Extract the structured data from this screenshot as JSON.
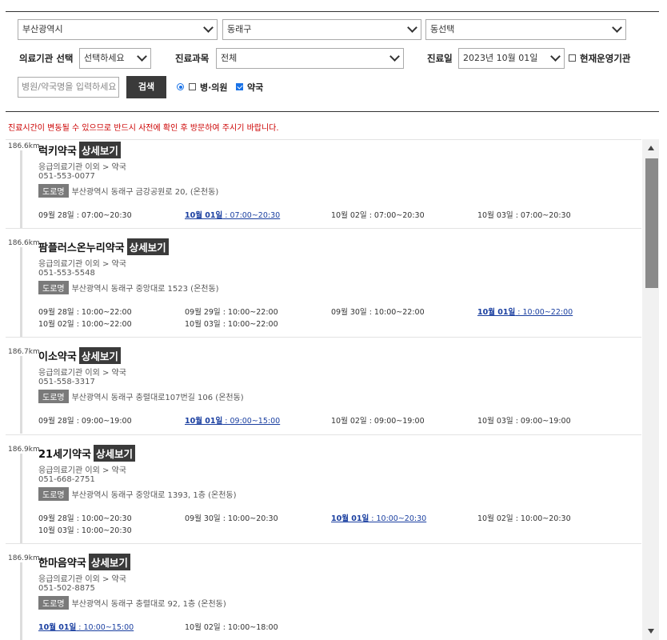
{
  "filters": {
    "city": "부산광역시",
    "district": "동래구",
    "dong": "동선택",
    "facility_label": "의료기관 선택",
    "facility_value": "선택하세요",
    "subject_label": "진료과목",
    "subject_value": "전체",
    "date_label": "진료일",
    "date_value": "2023년 10월 01일",
    "operating_label": "현재운영기관",
    "search_placeholder": "병원/약국명을 입력하세요",
    "search_button": "검색",
    "hospital_label": "병·의원",
    "pharmacy_label": "약국"
  },
  "notice": "진료시간이 변동될 수 있으므로 반드시 사전에 확인 후 방문하여 주시기 바랍니다.",
  "detail_label": "상세보기",
  "road_label": "도로명",
  "results": [
    {
      "distance": "186.6km",
      "name": "럭키약국",
      "category": "응급의료기관 이외 > 약국",
      "phone": "051-553-0077",
      "address": "부산광역시 동래구 금강공원로 20, (온천동)",
      "hours": [
        {
          "date": "09월 28일",
          "time": " : 07:00~20:30"
        },
        {
          "date": "10월 01일",
          "time": " : 07:00~20:30",
          "today": true
        },
        {
          "date": "10월 02일",
          "time": " : 07:00~20:30"
        },
        {
          "date": "10월 03일",
          "time": " : 07:00~20:30"
        }
      ]
    },
    {
      "distance": "186.6km",
      "name": "팜플러스온누리약국",
      "category": "응급의료기관 이외 > 약국",
      "phone": "051-553-5548",
      "address": "부산광역시 동래구 중앙대로 1523 (온천동)",
      "hours": [
        {
          "date": "09월 28일",
          "time": " : 10:00~22:00"
        },
        {
          "date": "09월 29일",
          "time": " : 10:00~22:00"
        },
        {
          "date": "09월 30일",
          "time": " : 10:00~22:00"
        },
        {
          "date": "10월 01일",
          "time": " : 10:00~22:00",
          "today": true
        },
        {
          "date": "10월 02일",
          "time": " : 10:00~22:00"
        },
        {
          "date": "10월 03일",
          "time": " : 10:00~22:00"
        }
      ]
    },
    {
      "distance": "186.7km",
      "name": "이소약국",
      "category": "응급의료기관 이외 > 약국",
      "phone": "051-558-3317",
      "address": "부산광역시 동래구 충렬대로107번길 106 (온천동)",
      "hours": [
        {
          "date": "09월 28일",
          "time": " : 09:00~19:00"
        },
        {
          "date": "10월 01일",
          "time": " : 09:00~15:00",
          "today": true
        },
        {
          "date": "10월 02일",
          "time": " : 09:00~19:00"
        },
        {
          "date": "10월 03일",
          "time": " : 09:00~19:00"
        }
      ]
    },
    {
      "distance": "186.9km",
      "name": "21세기약국",
      "category": "응급의료기관 이외 > 약국",
      "phone": "051-668-2751",
      "address": "부산광역시 동래구 중앙대로 1393, 1층 (온천동)",
      "hours": [
        {
          "date": "09월 28일",
          "time": " : 10:00~20:30"
        },
        {
          "date": "09월 30일",
          "time": " : 10:00~20:30"
        },
        {
          "date": "10월 01일",
          "time": " : 10:00~20:30",
          "today": true
        },
        {
          "date": "10월 02일",
          "time": " : 10:00~20:30"
        },
        {
          "date": "10월 03일",
          "time": " : 10:00~20:30"
        }
      ]
    },
    {
      "distance": "186.9km",
      "name": "한마음약국",
      "category": "응급의료기관 이외 > 약국",
      "phone": "051-502-8875",
      "address": "부산광역시 동래구 충렬대로 92, 1층 (온천동)",
      "hours": [
        {
          "date": "10월 01일",
          "time": " : 10:00~15:00",
          "today": true
        },
        {
          "date": "10월 02일",
          "time": " : 10:00~18:00"
        }
      ]
    }
  ]
}
